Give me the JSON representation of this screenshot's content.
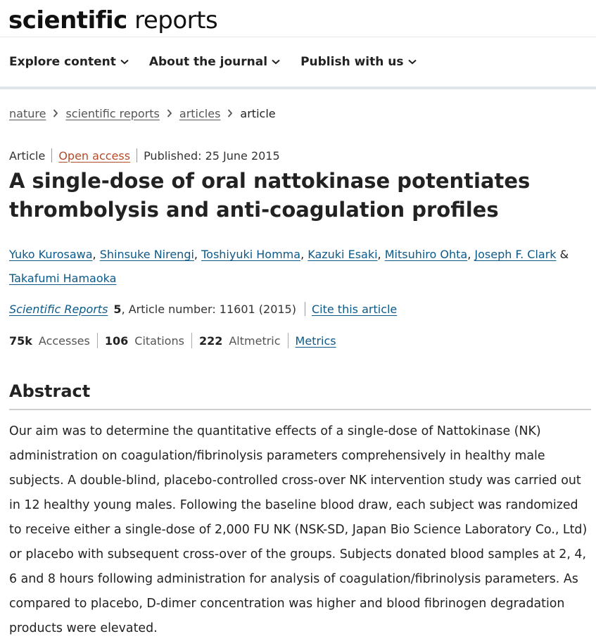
{
  "header": {
    "logo_bold": "scientific",
    "logo_light": " reports"
  },
  "nav": {
    "items": [
      "Explore content",
      "About the journal",
      "Publish with us"
    ]
  },
  "breadcrumb": {
    "items": [
      "nature",
      "scientific reports",
      "articles"
    ],
    "current": "article"
  },
  "meta": {
    "type": "Article",
    "open_access": "Open access",
    "published": "Published: 25 June 2015"
  },
  "title": "A single-dose of oral nattokinase potentiates thrombolysis and anti-coagulation profiles",
  "authors": [
    "Yuko Kurosawa",
    "Shinsuke Nirengi",
    "Toshiyuki Homma",
    "Kazuki Esaki",
    "Mitsuhiro Ohta",
    "Joseph F. Clark",
    "Takafumi Hamaoka"
  ],
  "authors_amp": "&",
  "citation": {
    "journal": "Scientific Reports",
    "volume": "5",
    "article_number": ", Article number: 11601 (2015)",
    "cite_link": "Cite this article"
  },
  "metrics": {
    "accesses_value": "75k",
    "accesses_label": "Accesses",
    "citations_value": "106",
    "citations_label": "Citations",
    "altmetric_value": "222",
    "altmetric_label": "Altmetric",
    "metrics_link": "Metrics"
  },
  "abstract": {
    "heading": "Abstract",
    "text": "Our aim was to determine the quantitative effects of a single-dose of Nattokinase (NK) administration on coagulation/fibrinolysis parameters comprehensively in healthy male subjects. A double-blind, placebo-controlled cross-over NK intervention study was carried out in 12 healthy young males. Following the baseline blood draw, each subject was randomized to receive either a single-dose of 2,000 FU NK (NSK-SD, Japan Bio Science Laboratory Co., Ltd) or placebo with subsequent cross-over of the groups. Subjects donated blood samples at 2, 4, 6 and 8 hours following administration for analysis of coagulation/fibrinolysis parameters. As compared to placebo, D-dimer concentration was higher and blood fibrinogen degradation products were elevated."
  },
  "icons": {
    "nav_chevron": "chevron-down-icon",
    "breadcrumb_sep": "chevron-right-icon"
  }
}
